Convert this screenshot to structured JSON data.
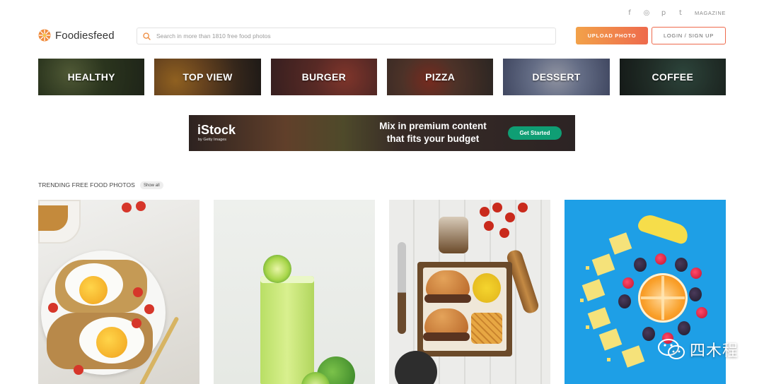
{
  "social": {
    "facebook": "f",
    "instagram": "◎",
    "pinterest": "p",
    "twitter": "t",
    "magazine_label": "MAGAZINE"
  },
  "header": {
    "logo_text": "Foodiesfeed",
    "search_placeholder": "Search in more than 1810 free food photos",
    "upload_label": "UPLOAD PHOTO",
    "login_label": "LOGIN / SIGN UP",
    "accent_color": "#ee6a4c"
  },
  "categories": [
    {
      "label": "HEALTHY"
    },
    {
      "label": "TOP VIEW"
    },
    {
      "label": "BURGER"
    },
    {
      "label": "PIZZA"
    },
    {
      "label": "DESSERT"
    },
    {
      "label": "COFFEE"
    }
  ],
  "ad": {
    "brand": "iStock",
    "brand_sub": "by Getty Images",
    "headline_line1": "Mix in premium content",
    "headline_line2": "that fits your budget",
    "cta_label": "Get Started",
    "cta_color": "#0f9e74"
  },
  "trending": {
    "title": "TRENDING FREE FOOD PHOTOS",
    "show_all_label": "Show all"
  },
  "watermark": {
    "text": "四木程"
  }
}
